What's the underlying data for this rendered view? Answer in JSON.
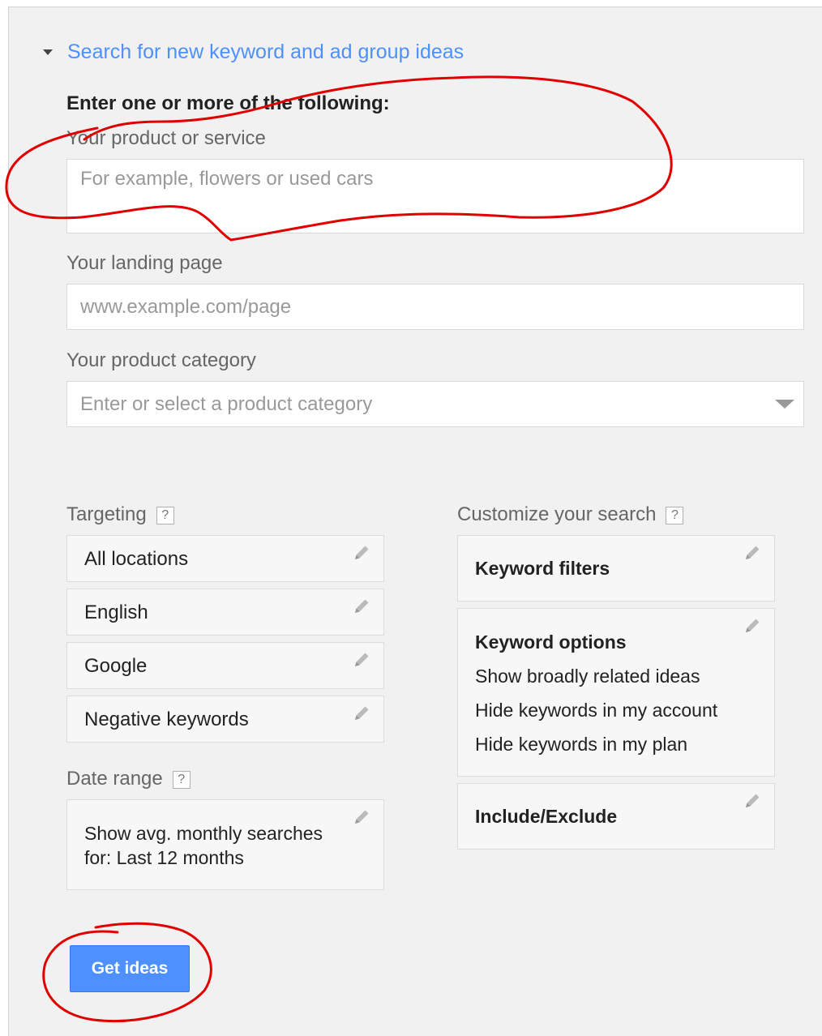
{
  "section": {
    "title": "Search for new keyword and ad group ideas",
    "heading": "Enter one or more of the following:"
  },
  "product": {
    "label": "Your product or service",
    "placeholder": "For example, flowers or used cars"
  },
  "landing": {
    "label": "Your landing page",
    "placeholder": "www.example.com/page"
  },
  "category": {
    "label": "Your product category",
    "placeholder": "Enter or select a product category"
  },
  "targeting": {
    "label": "Targeting",
    "help": "?",
    "items": [
      "All locations",
      "English",
      "Google",
      "Negative keywords"
    ]
  },
  "date_range": {
    "label": "Date range",
    "help": "?",
    "line1": "Show avg. monthly searches",
    "line2": "for: Last 12 months"
  },
  "customize": {
    "label": "Customize your search",
    "help": "?",
    "keyword_filters": "Keyword filters",
    "keyword_options": {
      "title": "Keyword options",
      "lines": [
        "Show broadly related ideas",
        "Hide keywords in my account",
        "Hide keywords in my plan"
      ]
    },
    "include_exclude": "Include/Exclude"
  },
  "button": {
    "label": "Get ideas"
  },
  "colors": {
    "accent": "#4d90fe",
    "annotation": "#e00000",
    "panel_bg": "#f1f1f1"
  },
  "icons": {
    "caret": "caret-down-icon",
    "pencil": "pencil-icon",
    "help": "help-icon",
    "dropdown": "dropdown-arrow-icon"
  }
}
